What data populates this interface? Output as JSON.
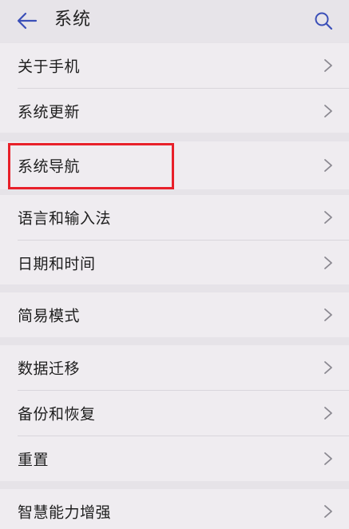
{
  "header": {
    "title": "系统"
  },
  "icons": {
    "back": "arrow-left-icon",
    "search": "search-icon",
    "chevron": "chevron-right-icon"
  },
  "colors": {
    "accent": "#3b4fb8",
    "highlight": "#e8202a"
  },
  "groups": [
    {
      "items": [
        {
          "label": "关于手机"
        },
        {
          "label": "系统更新"
        }
      ]
    },
    {
      "items": [
        {
          "label": "系统导航"
        }
      ]
    },
    {
      "items": [
        {
          "label": "语言和输入法"
        },
        {
          "label": "日期和时间"
        }
      ]
    },
    {
      "items": [
        {
          "label": "简易模式"
        }
      ]
    },
    {
      "items": [
        {
          "label": "数据迁移"
        },
        {
          "label": "备份和恢复"
        },
        {
          "label": "重置"
        }
      ]
    },
    {
      "items": [
        {
          "label": "智慧能力增强"
        }
      ]
    }
  ]
}
